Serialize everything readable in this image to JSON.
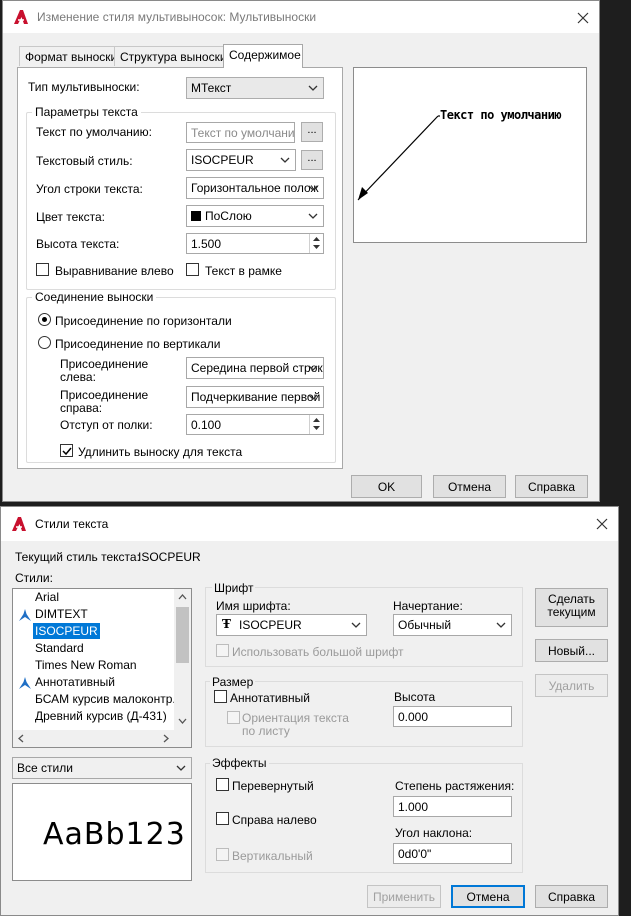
{
  "mleader_dialog": {
    "title": "Изменение стиля мультивыносок: Мультивыноски",
    "tabs": [
      "Формат выноски",
      "Структура выноски",
      "Содержимое"
    ],
    "multileader_type_label": "Тип мультивыноски:",
    "multileader_type_value": "МТекст",
    "text_params_group": "Параметры текста",
    "default_text_label": "Текст по умолчанию:",
    "default_text_value": "Текст по умолчанию",
    "text_style_label": "Текстовый стиль:",
    "text_style_value": "ISOCPEUR",
    "text_angle_label": "Угол строки текста:",
    "text_angle_value": "Горизонтальное полож",
    "text_color_label": "Цвет текста:",
    "text_color_value": "ПоСлою",
    "text_height_label": "Высота текста:",
    "text_height_value": "1.500",
    "left_justify_label": "Выравнивание влево",
    "frame_text_label": "Текст в рамке",
    "browse_label": "...",
    "connection_group": "Соединение выноски",
    "horizontal_attach_label": "Присоединение по горизонтали",
    "vertical_attach_label": "Присоединение по вертикали",
    "left_attach_label": "Присоединение слева:",
    "left_attach_value": "Середина первой строк",
    "right_attach_label": "Присоединение справа:",
    "right_attach_value": "Подчеркивание первой",
    "landing_gap_label": "Отступ от полки:",
    "landing_gap_value": "0.100",
    "extend_leader_label": "Удлинить выноску для текста",
    "preview_text": "Текст по умолчанию",
    "ok_label": "OK",
    "cancel_label": "Отмена",
    "help_label": "Справка"
  },
  "text_style_dialog": {
    "title": "Стили текста",
    "current_style_label": "Текущий стиль текста:",
    "current_style_value": "ISOCPEUR",
    "styles_label": "Стили:",
    "styles": [
      "Arial",
      "DIMTEXT",
      "ISOCPEUR",
      "Standard",
      "Times New Roman",
      "Аннотативный",
      "БСАМ курсив малоконтр...",
      "Древний курсив (Д-431)"
    ],
    "annotative_styles": [
      false,
      true,
      false,
      false,
      false,
      true,
      false,
      false
    ],
    "selected_style": "ISOCPEUR",
    "filter_value": "Все стили",
    "preview_sample": "AaBb123",
    "font_group": "Шрифт",
    "font_name_label": "Имя шрифта:",
    "font_name_value": "ISOCPEUR",
    "font_style_label": "Начертание:",
    "font_style_value": "Обычный",
    "big_font_label": "Использовать большой шрифт",
    "size_group": "Размер",
    "annotative_label": "Аннотативный",
    "orientation_label_1": "Ориентация текста",
    "orientation_label_2": "по листу",
    "height_label": "Высота",
    "height_value": "0.000",
    "effects_group": "Эффекты",
    "upside_down_label": "Перевернутый",
    "backwards_label": "Справа налево",
    "vertical_label": "Вертикальный",
    "width_factor_label": "Степень растяжения:",
    "width_factor_value": "1.000",
    "oblique_label": "Угол наклона:",
    "oblique_value": "0d0'0\"",
    "set_current_label_1": "Сделать",
    "set_current_label_2": "текущим",
    "new_label": "Новый...",
    "delete_label": "Удалить",
    "apply_label": "Применить",
    "cancel_label": "Отмена",
    "help_label": "Справка"
  },
  "colors": {
    "accent": "#0078d7",
    "autocad_red": "#c8102e",
    "annotative_icon": "#1f6fc5"
  }
}
